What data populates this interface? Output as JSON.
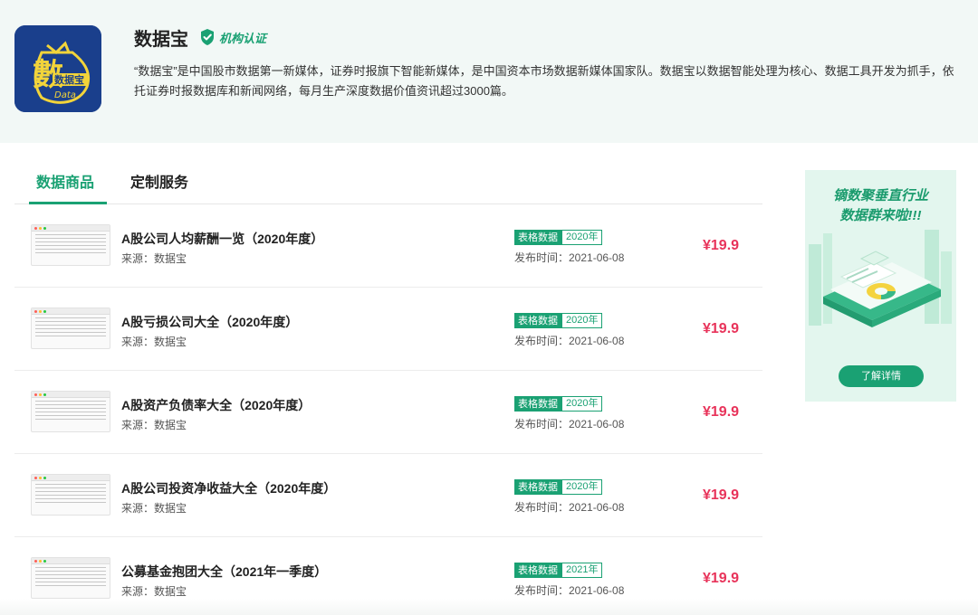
{
  "header": {
    "logo_text": "数据宝",
    "logo_subtext": "Data",
    "title": "数据宝",
    "verify_label": "机构认证",
    "description": "“数据宝”是中国股市数据第一新媒体，证券时报旗下智能新媒体，是中国资本市场数据新媒体国家队。数据宝以数据智能处理为核心、数据工具开发为抓手，依托证券时报数据库和新闻网络，每月生产深度数据价值资讯超过3000篇。"
  },
  "tabs": [
    {
      "label": "数据商品",
      "active": true
    },
    {
      "label": "定制服务",
      "active": false
    }
  ],
  "products": [
    {
      "name": "A股公司人均薪酬一览（2020年度）",
      "source": "来源：数据宝",
      "type": "表格数据",
      "year": "2020年",
      "published": "发布时间：2021-06-08",
      "price": "¥19.9"
    },
    {
      "name": "A股亏损公司大全（2020年度）",
      "source": "来源：数据宝",
      "type": "表格数据",
      "year": "2020年",
      "published": "发布时间：2021-06-08",
      "price": "¥19.9"
    },
    {
      "name": "A股资产负债率大全（2020年度）",
      "source": "来源：数据宝",
      "type": "表格数据",
      "year": "2020年",
      "published": "发布时间：2021-06-08",
      "price": "¥19.9"
    },
    {
      "name": "A股公司投资净收益大全（2020年度）",
      "source": "来源：数据宝",
      "type": "表格数据",
      "year": "2020年",
      "published": "发布时间：2021-06-08",
      "price": "¥19.9"
    },
    {
      "name": "公募基金抱团大全（2021年一季度）",
      "source": "来源：数据宝",
      "type": "表格数据",
      "year": "2021年",
      "published": "发布时间：2021-06-08",
      "price": "¥19.9"
    }
  ],
  "ad": {
    "title_line1": "镝数聚垂直行业",
    "title_line2": "数据群来啦!!!",
    "button": "了解详情"
  },
  "colors": {
    "accent": "#1aa173",
    "price": "#e8335a",
    "logo_bg": "#1a3f8c",
    "header_bg": "#f2f8f6"
  }
}
